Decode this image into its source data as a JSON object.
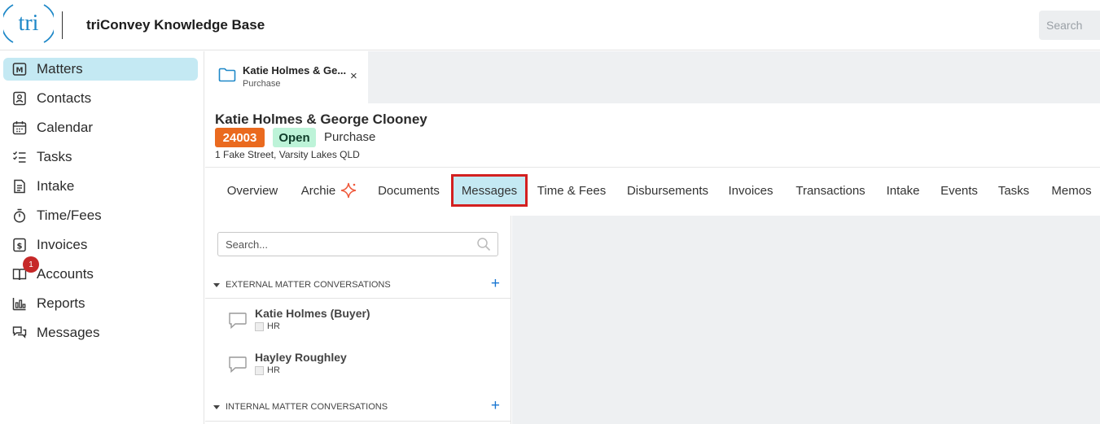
{
  "header": {
    "logo_text": "tri",
    "app_title": "triConvey Knowledge Base",
    "search_placeholder": "Search"
  },
  "sidebar": {
    "items": [
      {
        "label": "Matters",
        "icon": "matters-icon",
        "active": true
      },
      {
        "label": "Contacts",
        "icon": "contacts-icon"
      },
      {
        "label": "Calendar",
        "icon": "calendar-icon"
      },
      {
        "label": "Tasks",
        "icon": "tasks-icon"
      },
      {
        "label": "Intake",
        "icon": "intake-icon"
      },
      {
        "label": "Time/Fees",
        "icon": "stopwatch-icon"
      },
      {
        "label": "Invoices",
        "icon": "invoice-icon"
      },
      {
        "label": "Accounts",
        "icon": "accounts-icon",
        "badge": "1"
      },
      {
        "label": "Reports",
        "icon": "reports-icon"
      },
      {
        "label": "Messages",
        "icon": "messages-icon"
      }
    ]
  },
  "open_tab": {
    "title": "Katie Holmes & Ge...",
    "subtitle": "Purchase",
    "close": "×"
  },
  "matter": {
    "name": "Katie Holmes & George Clooney",
    "number": "24003",
    "status": "Open",
    "type": "Purchase",
    "address": "1 Fake Street, Varsity Lakes QLD"
  },
  "tabs": [
    "Overview",
    "Archie",
    "Documents",
    "Messages",
    "Time & Fees",
    "Disbursements",
    "Invoices",
    "Transactions",
    "Intake",
    "Events",
    "Tasks",
    "Memos"
  ],
  "active_tab": "Messages",
  "messages": {
    "search_placeholder": "Search...",
    "external_heading": "EXTERNAL MATTER CONVERSATIONS",
    "internal_heading": "INTERNAL MATTER CONVERSATIONS",
    "add_label": "+",
    "conversations": [
      {
        "name": "Katie Holmes (Buyer)",
        "initials": "HR"
      },
      {
        "name": "Hayley Roughley",
        "initials": "HR"
      }
    ]
  },
  "colors": {
    "accent_active": "#c4e9f3",
    "highlight_border": "#d32020",
    "matter_number": "#ea6a1f",
    "status_open": "#bdf3d8",
    "logo_blue": "#1e88c8",
    "add_blue": "#1976d2"
  }
}
